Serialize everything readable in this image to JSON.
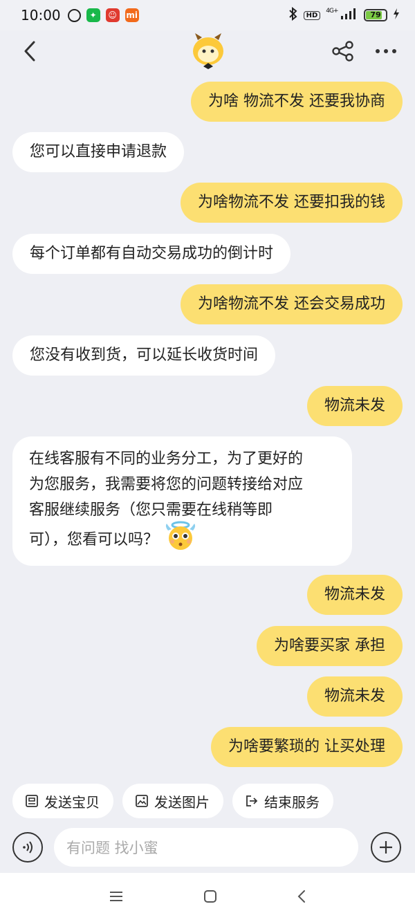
{
  "status_bar": {
    "time": "10:00",
    "network": "4G+",
    "hd": "HD",
    "battery": "79",
    "icons": [
      "alarm-icon",
      "wechat-icon",
      "app-red-icon",
      "mi-icon",
      "bluetooth-icon",
      "signal-icon",
      "battery-icon",
      "charging-icon"
    ]
  },
  "header": {
    "icons": [
      "back-icon",
      "mascot-logo-icon",
      "share-icon",
      "more-icon"
    ]
  },
  "messages": [
    {
      "from": "me",
      "text": "为啥 物流不发  还要我协商"
    },
    {
      "from": "them",
      "text": "您可以直接申请退款"
    },
    {
      "from": "me",
      "text": "为啥物流不发 还要扣我的钱"
    },
    {
      "from": "them",
      "text": "每个订单都有自动交易成功的倒计时"
    },
    {
      "from": "me",
      "text": "为啥物流不发 还会交易成功"
    },
    {
      "from": "them",
      "text": "您没有收到货，可以延长收货时间"
    },
    {
      "from": "me",
      "text": "物流未发"
    },
    {
      "from": "them",
      "text": "在线客服有不同的业务分工，为了更好的为您服务，我需要将您的问题转接给对应客服继续服务（您只需要在线稍等即可），您看可以吗？",
      "lines": [
        "在线客服有不同的业务分工，为了更好的",
        "为您服务，我需要将您的问题转接给对应",
        "客服继续服务（您只需要在线稍等即",
        "可），您看可以吗？"
      ],
      "emoji": "angel-face-emoji"
    },
    {
      "from": "me",
      "text": "物流未发"
    },
    {
      "from": "me",
      "text": "为啥要买家 承担"
    },
    {
      "from": "me",
      "text": "物流未发"
    },
    {
      "from": "me",
      "text": "为啥要繁琐的 让买处理"
    }
  ],
  "quick_actions": [
    {
      "label": "发送宝贝",
      "icon": "product-icon"
    },
    {
      "label": "发送图片",
      "icon": "image-icon"
    },
    {
      "label": "结束服务",
      "icon": "exit-icon"
    }
  ],
  "input": {
    "placeholder": "有问题 找小蜜",
    "icons": [
      "voice-icon",
      "plus-icon"
    ]
  },
  "nav": {
    "icons": [
      "menu-icon",
      "home-icon",
      "back-nav-icon"
    ]
  },
  "colors": {
    "my_bubble": "#fcdf72",
    "their_bubble": "#ffffff",
    "background": "#eeeff4"
  }
}
